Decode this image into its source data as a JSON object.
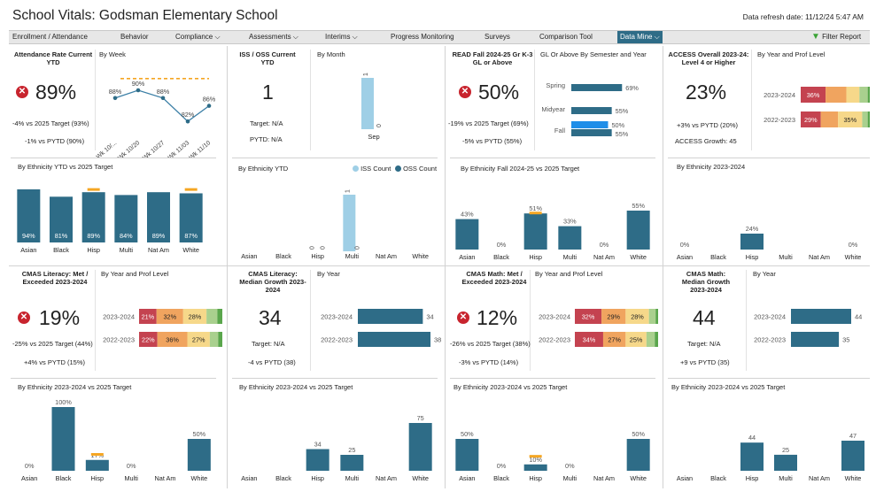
{
  "header": {
    "title": "School Vitals: Godsman Elementary School",
    "refresh": "Data refresh date:  11/12/24 5:47 AM"
  },
  "nav": {
    "items": [
      "Enrollment / Attendance",
      "Behavior",
      "Compliance ⌵",
      "Assessments ⌵",
      "Interims ⌵",
      "Progress Monitoring",
      "Surveys",
      "Comparison Tool",
      "Data Mine ⌵"
    ],
    "filter": "Filter Report"
  },
  "colors": {
    "teal": "#2e6c87",
    "light": "#9fcfe6",
    "orange": "#f5a623",
    "red": "#c8242e"
  },
  "attendance": {
    "title": "Attendance Rate Current YTD",
    "value": "89%",
    "line1": "-4% vs 2025 Target (93%)",
    "line2": "-1% vs PYTD (90%)",
    "week_title": "By Week",
    "ethnicity_title": "By Ethnicity YTD vs 2025 Target"
  },
  "iss": {
    "title": "ISS / OSS Current YTD",
    "value": "1",
    "target": "Target:  N/A",
    "pytd": "PYTD:  N/A",
    "month_title": "By Month",
    "ethnicity_title": "By Ethnicity YTD",
    "legend_iss": "ISS Count",
    "legend_oss": "OSS Count"
  },
  "read": {
    "title": "READ Fall 2024-25 Gr K-3 GL or Above",
    "value": "50%",
    "line1": "-19% vs 2025 Target (69%)",
    "line2": "-5% vs PYTD (55%)",
    "sem_title": "GL Or Above By Semester and Year",
    "ethnicity_title": "By Ethnicity Fall 2024-25 vs 2025 Target"
  },
  "access": {
    "title": "ACCESS Overall 2023-24: Level 4 or Higher",
    "value": "23%",
    "line1": "+3% vs PYTD (20%)",
    "line2": "ACCESS Growth:  45",
    "year_title": "By Year and Prof Level",
    "ethnicity_title": "By Ethnicity 2023-2024"
  },
  "cmas_lit": {
    "title": "CMAS Literacy: Met / Exceeded 2023-2024",
    "value": "19%",
    "line1": "-25% vs 2025 Target (44%)",
    "line2": "+4% vs PYTD (15%)",
    "year_title": "By Year and Prof Level",
    "ethnicity_title": "By Ethnicity 2023-2024 vs 2025 Target"
  },
  "cmas_lit_growth": {
    "title": "CMAS Literacy: Median Growth 2023-2024",
    "value": "34",
    "target": "Target:  N/A",
    "line2": "-4 vs PYTD (38)",
    "year_title": "By Year",
    "ethnicity_title": "By Ethnicity 2023-2024 vs 2025 Target"
  },
  "cmas_math": {
    "title": "CMAS Math: Met / Exceeded 2023-2024",
    "value": "12%",
    "line1": "-26% vs 2025 Target (38%)",
    "line2": "-3% vs PYTD (14%)",
    "year_title": "By Year and Prof Level",
    "ethnicity_title": "By Ethnicity 2023-2024 vs 2025 Target"
  },
  "cmas_math_growth": {
    "title": "CMAS Math: Median Growth 2023-2024",
    "value": "44",
    "target": "Target:  N/A",
    "line2": "+9 vs PYTD (35)",
    "year_title": "By Year",
    "ethnicity_title": "By Ethnicity 2023-2024 vs 2025 Target"
  },
  "chart_data": [
    {
      "id": "att_week",
      "type": "line",
      "x": [
        "Wk 10/...",
        "Wk 10/20",
        "Wk 10/27",
        "Wk 11/03",
        "Wk 11/10"
      ],
      "values": [
        88,
        90,
        88,
        82,
        86
      ],
      "labels": [
        "88%",
        "90%",
        "88%",
        "82%",
        "86%"
      ],
      "target": 93
    },
    {
      "id": "att_eth",
      "type": "bar",
      "categories": [
        "Asian",
        "Black",
        "Hisp",
        "Multi",
        "Nat Am",
        "White"
      ],
      "values": [
        94,
        81,
        89,
        84,
        89,
        87
      ],
      "labels": [
        "94%",
        "81%",
        "89%",
        "84%",
        "89%",
        "87%"
      ],
      "target_marks": [
        null,
        null,
        93,
        null,
        null,
        93
      ]
    },
    {
      "id": "iss_month",
      "type": "bar",
      "categories": [
        "Sep"
      ],
      "series": [
        {
          "name": "ISS Count",
          "values": [
            1
          ]
        },
        {
          "name": "OSS Count",
          "values": [
            0
          ]
        }
      ]
    },
    {
      "id": "iss_eth",
      "type": "bar",
      "categories": [
        "Asian",
        "Black",
        "Hisp",
        "Multi",
        "Nat Am",
        "White"
      ],
      "series": [
        {
          "name": "ISS Count",
          "values": [
            null,
            null,
            0,
            1,
            null,
            null
          ]
        },
        {
          "name": "OSS Count",
          "values": [
            null,
            null,
            0,
            0,
            null,
            null
          ]
        }
      ]
    },
    {
      "id": "read_sem",
      "type": "bar",
      "categories": [
        "Spring",
        "Midyear",
        "Fall"
      ],
      "series": [
        {
          "name": "2023-24",
          "values": [
            69,
            55,
            55
          ]
        },
        {
          "name": "2024-25",
          "values": [
            null,
            null,
            50
          ]
        }
      ]
    },
    {
      "id": "read_eth",
      "type": "bar",
      "categories": [
        "Asian",
        "Black",
        "Hisp",
        "Multi",
        "Nat Am",
        "White"
      ],
      "values": [
        43,
        0,
        51,
        33,
        0,
        55
      ],
      "labels": [
        "43%",
        "0%",
        "51%",
        "33%",
        "0%",
        "55%"
      ]
    },
    {
      "id": "access_year",
      "type": "bar",
      "categories": [
        "2023-2024",
        "2022-2023"
      ],
      "series": [
        {
          "name": "L1",
          "values": [
            36,
            29
          ]
        },
        {
          "name": "L2",
          "values": [
            30,
            25
          ]
        },
        {
          "name": "L3",
          "values": [
            19,
            35
          ]
        },
        {
          "name": "L4",
          "values": [
            12,
            8
          ]
        },
        {
          "name": "L5",
          "values": [
            3,
            3
          ]
        }
      ],
      "labels": [
        [
          "36%",
          "",
          "",
          "",
          ""
        ],
        [
          "29%",
          "",
          "35%",
          "",
          ""
        ]
      ]
    },
    {
      "id": "access_eth",
      "type": "bar",
      "categories": [
        "Asian",
        "Black",
        "Hisp",
        "Multi",
        "Nat Am",
        "White"
      ],
      "values": [
        0,
        null,
        24,
        null,
        null,
        0
      ],
      "labels": [
        "0%",
        "",
        "24%",
        "",
        "",
        "0%"
      ]
    },
    {
      "id": "lit_year",
      "type": "bar",
      "categories": [
        "2023-2024",
        "2022-2023"
      ],
      "series": [
        {
          "name": "L1",
          "values": [
            21,
            22
          ]
        },
        {
          "name": "L2",
          "values": [
            32,
            36
          ]
        },
        {
          "name": "L3",
          "values": [
            28,
            27
          ]
        },
        {
          "name": "L4",
          "values": [
            13,
            10
          ]
        },
        {
          "name": "L5",
          "values": [
            6,
            5
          ]
        }
      ],
      "labels": [
        [
          "21%",
          "32%",
          "28%",
          "",
          ""
        ],
        [
          "22%",
          "36%",
          "27%",
          "",
          ""
        ]
      ]
    },
    {
      "id": "lit_eth",
      "type": "bar",
      "categories": [
        "Asian",
        "Black",
        "Hisp",
        "Multi",
        "Nat Am",
        "White"
      ],
      "values": [
        0,
        100,
        17,
        0,
        null,
        50
      ],
      "labels": [
        "0%",
        "100%",
        "17%",
        "0%",
        "",
        "50%"
      ],
      "target_marks": [
        null,
        null,
        25,
        null,
        null,
        null
      ]
    },
    {
      "id": "litg_year",
      "type": "bar",
      "categories": [
        "2023-2024",
        "2022-2023"
      ],
      "values": [
        34,
        38
      ]
    },
    {
      "id": "litg_eth",
      "type": "bar",
      "categories": [
        "Asian",
        "Black",
        "Hisp",
        "Multi",
        "Nat Am",
        "White"
      ],
      "values": [
        null,
        null,
        34,
        25,
        null,
        75
      ]
    },
    {
      "id": "math_year",
      "type": "bar",
      "categories": [
        "2023-2024",
        "2022-2023"
      ],
      "series": [
        {
          "name": "L1",
          "values": [
            32,
            34
          ]
        },
        {
          "name": "L2",
          "values": [
            29,
            27
          ]
        },
        {
          "name": "L3",
          "values": [
            28,
            25
          ]
        },
        {
          "name": "L4",
          "values": [
            8,
            10
          ]
        },
        {
          "name": "L5",
          "values": [
            3,
            4
          ]
        }
      ],
      "labels": [
        [
          "32%",
          "29%",
          "28%",
          "",
          ""
        ],
        [
          "34%",
          "27%",
          "25%",
          "",
          ""
        ]
      ]
    },
    {
      "id": "math_eth",
      "type": "bar",
      "categories": [
        "Asian",
        "Black",
        "Hisp",
        "Multi",
        "Nat Am",
        "White"
      ],
      "values": [
        50,
        0,
        10,
        0,
        null,
        50
      ],
      "labels": [
        "50%",
        "0%",
        "10%",
        "0%",
        "",
        "50%"
      ],
      "target_marks": [
        null,
        null,
        22,
        null,
        null,
        null
      ]
    },
    {
      "id": "mathg_year",
      "type": "bar",
      "categories": [
        "2023-2024",
        "2022-2023"
      ],
      "values": [
        44,
        35
      ]
    },
    {
      "id": "mathg_eth",
      "type": "bar",
      "categories": [
        "Asian",
        "Black",
        "Hisp",
        "Multi",
        "Nat Am",
        "White"
      ],
      "values": [
        null,
        null,
        44,
        25,
        null,
        47
      ]
    }
  ]
}
